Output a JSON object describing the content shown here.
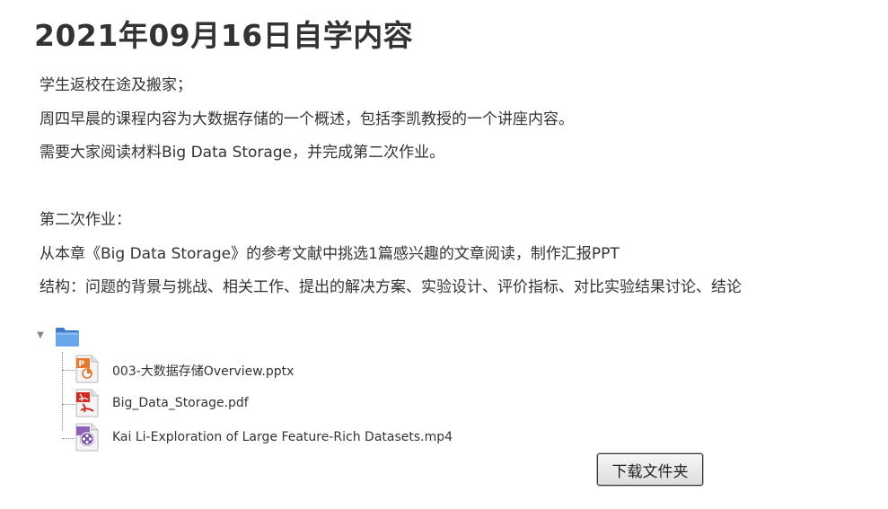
{
  "page": {
    "title": "2021年09月16日自学内容"
  },
  "intro": {
    "paragraphs": [
      "学生返校在途及搬家；",
      "周四早晨的课程内容为大数据存储的一个概述，包括李凯教授的一个讲座内容。",
      "需要大家阅读材料Big Data Storage，并完成第二次作业。",
      "",
      "第二次作业：",
      "从本章《Big Data Storage》的参考文献中挑选1篇感兴趣的文章阅读，制作汇报PPT",
      "结构：问题的背景与挑战、相关工作、提出的解决方案、实验设计、评价指标、对比实验结果讨论、结论"
    ]
  },
  "folder": {
    "toggle_icon": "triangle-down-icon",
    "folder_icon": "folder-icon",
    "files": [
      {
        "name": "003-大数据存储Overview.pptx",
        "icon": "powerpoint-file-icon"
      },
      {
        "name": "Big_Data_Storage.pdf",
        "icon": "pdf-file-icon"
      },
      {
        "name": "Kai Li-Exploration of Large Feature-Rich Datasets.mp4",
        "icon": "video-file-icon"
      }
    ],
    "download_label": "下载文件夹"
  },
  "colors": {
    "text": "#333333",
    "folder_blue": "#4f8fd8",
    "pptx_orange": "#e8772e",
    "pdf_red": "#d42a1f",
    "video_purple": "#7a4ea8"
  }
}
